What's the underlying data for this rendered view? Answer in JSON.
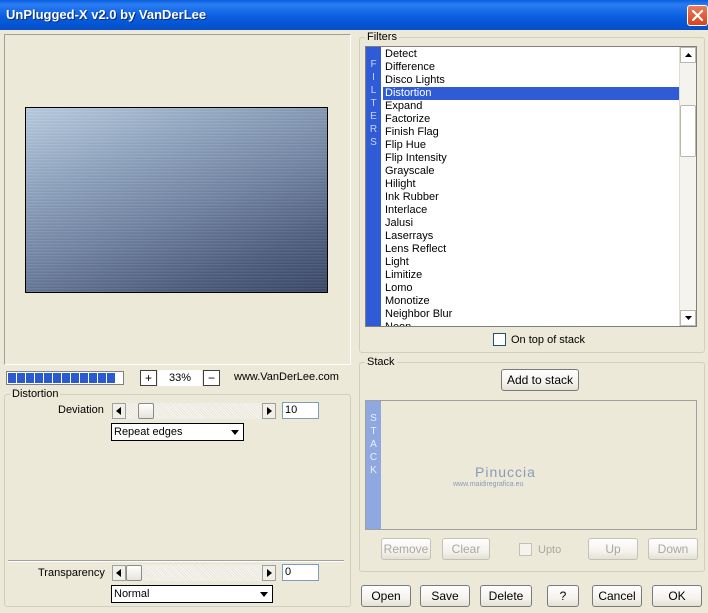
{
  "window": {
    "title": "UnPlugged-X v2.0 by VanDerLee",
    "close_icon": "close-icon"
  },
  "preview": {
    "progress_segments": 12,
    "zoom": {
      "minus": "−",
      "plus": "+",
      "value": "33%"
    },
    "url": "www.VanDerLee.com"
  },
  "distortion": {
    "group_label": "Distortion",
    "deviation": {
      "label": "Deviation",
      "value": "10",
      "slider_position": 0.1
    },
    "edge_mode": {
      "selected": "Repeat edges"
    }
  },
  "transparency": {
    "label": "Transparency",
    "value": "0",
    "slider_position": 0.0,
    "blend_mode": {
      "selected": "Normal"
    }
  },
  "filters": {
    "group_label": "Filters",
    "band_letters": [
      "F",
      "I",
      "L",
      "T",
      "E",
      "R",
      "S"
    ],
    "items": [
      "Detect",
      "Difference",
      "Disco Lights",
      "Distortion",
      "Expand",
      "Factorize",
      "Finish Flag",
      "Flip Hue",
      "Flip Intensity",
      "Grayscale",
      "Hilight",
      "Ink Rubber",
      "Interlace",
      "Jalusi",
      "Laserrays",
      "Lens Reflect",
      "Light",
      "Limitize",
      "Lomo",
      "Monotize",
      "Neighbor Blur",
      "Neon"
    ],
    "selected_index": 3,
    "on_top_label": "On top of stack"
  },
  "stack": {
    "group_label": "Stack",
    "band_letters": [
      "S",
      "T",
      "A",
      "C",
      "K"
    ],
    "add_label": "Add to stack",
    "watermark_name": "Pinuccia",
    "watermark_url": "www.maidiregrafica.eu",
    "remove_label": "Remove",
    "clear_label": "Clear",
    "upto_label": "Upto",
    "up_label": "Up",
    "down_label": "Down"
  },
  "footer": {
    "open": "Open",
    "save": "Save",
    "delete": "Delete",
    "help": "?",
    "cancel": "Cancel",
    "ok": "OK"
  },
  "colors": {
    "title_bar": "#0b5fe0",
    "selection": "#2f5bd6",
    "dialog_bg": "#ece9d8",
    "close_button": "#d8441c"
  }
}
